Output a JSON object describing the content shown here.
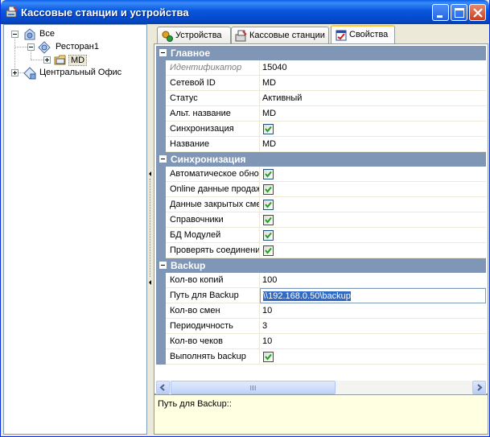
{
  "window": {
    "title": "Кассовые станции и устройства",
    "icon": "pos-station-icon"
  },
  "titlebar_buttons": {
    "minimize": "minimize-icon",
    "maximize": "maximize-icon",
    "close": "close-icon"
  },
  "tree": {
    "root": {
      "label": "Все",
      "icon": "network-icon",
      "expanded": true
    },
    "restaurant": {
      "label": "Ресторан1",
      "icon": "restaurant-icon",
      "expanded": true
    },
    "md": {
      "label": "MD",
      "icon": "folder-icon",
      "expanded": false,
      "selected": true
    },
    "office": {
      "label": "Центральный Офис",
      "icon": "office-icon",
      "expanded": false
    }
  },
  "tabs": [
    {
      "label": "Устройства",
      "icon": "devices-icon",
      "active": false
    },
    {
      "label": "Кассовые станции",
      "icon": "pos-station-icon",
      "active": false
    },
    {
      "label": "Свойства",
      "icon": "properties-icon",
      "active": true
    }
  ],
  "properties": {
    "categories": [
      {
        "label": "Главное",
        "rows": [
          {
            "name": "Идентификатор",
            "value": "15040",
            "disabled": true
          },
          {
            "name": "Сетевой ID",
            "value": "MD"
          },
          {
            "name": "Статус",
            "value": "Активный"
          },
          {
            "name": "Альт. название",
            "value": "MD"
          },
          {
            "name": "Синхронизация",
            "checked": true
          },
          {
            "name": "Название",
            "value": "MD"
          }
        ]
      },
      {
        "label": "Синхронизация",
        "rows": [
          {
            "name": "Автоматическое обновление",
            "checked": true
          },
          {
            "name": "Online данные продаж",
            "checked": true
          },
          {
            "name": "Данные закрытых смен",
            "checked": true
          },
          {
            "name": "Справочники",
            "checked": true
          },
          {
            "name": "БД Модулей",
            "checked": true
          },
          {
            "name": "Проверять соединение",
            "checked": true
          }
        ]
      },
      {
        "label": "Backup",
        "rows": [
          {
            "name": "Кол-во копий",
            "value": "100"
          },
          {
            "name": "Путь для Backup",
            "value": "\\\\192.168.0.50\\backup",
            "editing": true
          },
          {
            "name": "Кол-во смен",
            "value": "10"
          },
          {
            "name": "Периодичность",
            "value": "3"
          },
          {
            "name": "Кол-во чеков",
            "value": "10"
          },
          {
            "name": "Выполнять backup",
            "checked": true
          }
        ]
      }
    ]
  },
  "help": {
    "text": "Путь для Backup::"
  },
  "colors": {
    "titlebar": "#0856dd",
    "category_bg": "#7f96b6",
    "selection": "#316ac5",
    "help_bg": "#ffffe1",
    "check": "#21a121"
  }
}
